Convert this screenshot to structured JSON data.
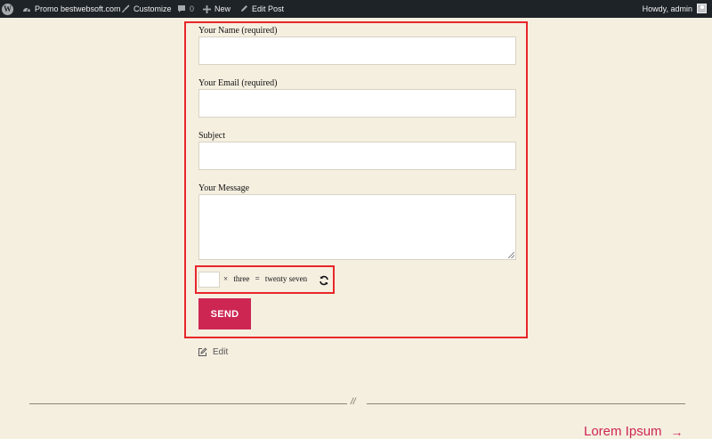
{
  "admin_bar": {
    "site_name": "Promo bestwebsoft.com",
    "customize": "Customize",
    "comments_count": "0",
    "new": "New",
    "edit_post": "Edit Post",
    "howdy": "Howdy, admin"
  },
  "form": {
    "name_label": "Your Name (required)",
    "name_value": "",
    "email_label": "Your Email (required)",
    "email_value": "",
    "subject_label": "Subject",
    "subject_value": "",
    "message_label": "Your Message",
    "message_value": "",
    "captcha": {
      "answer_value": "",
      "operator": "×",
      "operand": "three",
      "equals": "=",
      "result": "twenty seven"
    },
    "send_label": "SEND"
  },
  "edit_label": "Edit",
  "divider_mark": "//",
  "next_post": {
    "title": "Lorem Ipsum",
    "arrow": "→"
  },
  "colors": {
    "background": "#f5efe0",
    "accent": "#cd2653",
    "highlight_border": "#e8262a",
    "admin_bar": "#1d2327"
  }
}
